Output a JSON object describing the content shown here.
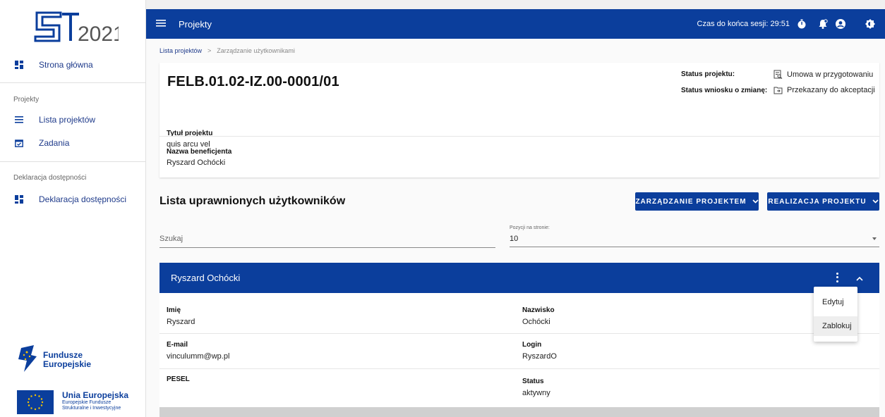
{
  "sidebar": {
    "logo_text": "2021",
    "home_label": "Strona główna",
    "section_projects": "Projekty",
    "projects_list_label": "Lista projektów",
    "tasks_label": "Zadania",
    "section_accessibility": "Deklaracja dostępności",
    "accessibility_label": "Deklaracja dostępności",
    "fe_logo_line1": "Fundusze",
    "fe_logo_line2": "Europejskie",
    "ue_logo_title": "Unia Europejska",
    "ue_logo_line1": "Europejskie Fundusze",
    "ue_logo_line2": "Strukturalne i Inwestycyjne"
  },
  "topbar": {
    "title": "Projekty",
    "session_text": "Czas do końca sesji: 29:51"
  },
  "breadcrumb": {
    "link": "Lista projektów",
    "separator": ">",
    "current": "Zarządzanie użytkownikami"
  },
  "project": {
    "id": "FELB.01.02-IZ.00-0001/01",
    "status_label": "Status projektu:",
    "status_value": "Umowa w przygotowaniu",
    "change_status_label": "Status wniosku o zmianę:",
    "change_status_value": "Przekazany do akceptacji",
    "title_label": "Tytuł projektu",
    "title_value": "quis arcu vel",
    "beneficiary_label": "Nazwa beneficjenta",
    "beneficiary_value": "Ryszard Ochócki"
  },
  "users": {
    "list_title": "Lista uprawnionych użytkowników",
    "btn_manage": "ZARZĄDZANIE PROJEKTEM",
    "btn_realize": "REALIZACJA PROJEKTU",
    "search_placeholder": "Szukaj",
    "per_page_label": "Pozycji na stronie:",
    "per_page_value": "10"
  },
  "user": {
    "header_name": "Ryszard Ochócki",
    "first_name_label": "Imię",
    "first_name_value": "Ryszard",
    "last_name_label": "Nazwisko",
    "last_name_value": "Ochócki",
    "email_label": "E-mail",
    "email_value": "vinculumm@wp.pl",
    "login_label": "Login",
    "login_value": "RyszardO",
    "pesel_label": "PESEL",
    "status_label": "Status",
    "status_value": "aktywny"
  },
  "context_menu": {
    "edit": "Edytuj",
    "block": "Zablokuj"
  },
  "colors": {
    "primary": "#0b3e9c",
    "link": "#1e3a8a"
  }
}
